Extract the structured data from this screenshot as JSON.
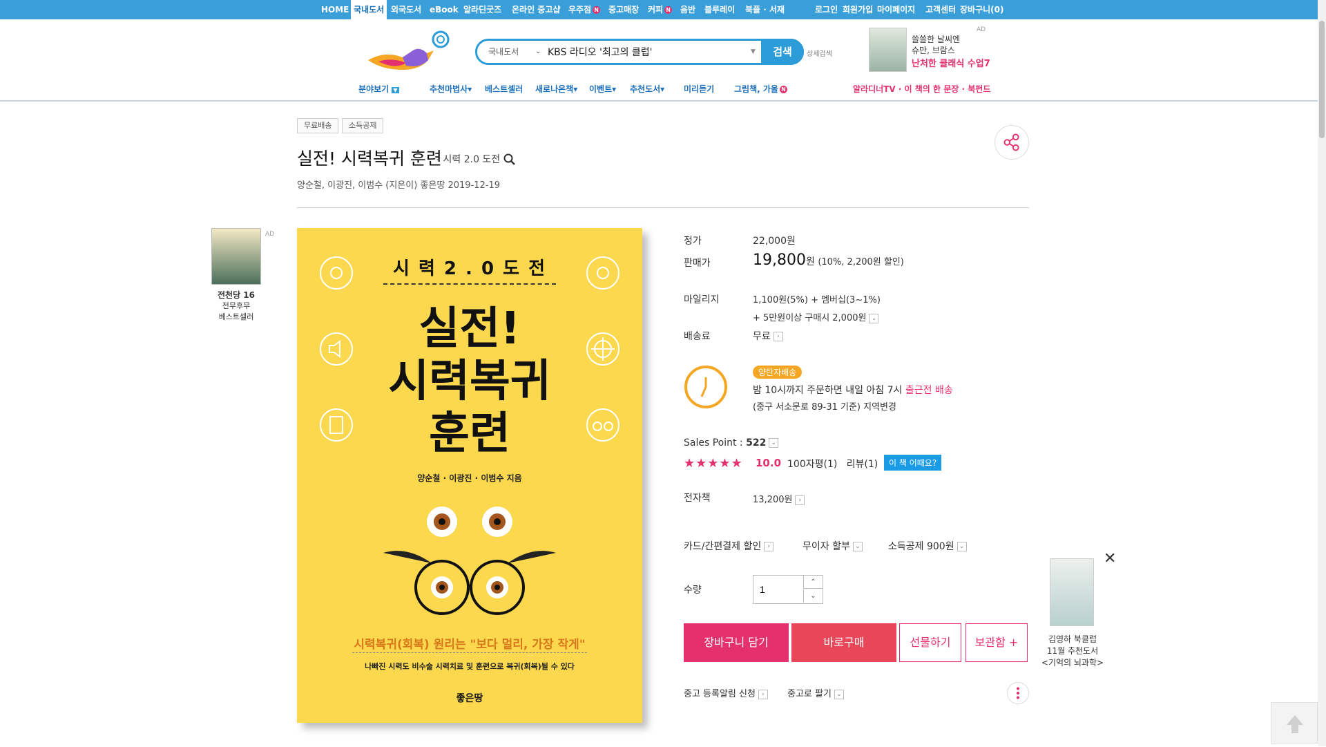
{
  "topbar": {
    "items": [
      "HOME",
      "국내도서",
      "외국도서",
      "eBook",
      "알라딘굿즈",
      "온라인 중고샵",
      "우주점",
      "중고매장",
      "커피",
      "음반",
      "블루레이",
      "북플 · 서재"
    ],
    "active": "국내도서",
    "new_badge": "N",
    "right_items": [
      "로그인",
      "회원가입",
      "마이페이지",
      "고객센터",
      "장바구니(0)"
    ]
  },
  "header": {
    "search_category": "국내도서",
    "search_value": "KBS 라디오 '최고의 클럽'",
    "search_button": "검색",
    "advanced_search": "상세검색",
    "ad_tag": "AD",
    "ad_line1": "쓸쓸한 날씨엔",
    "ad_line2": "슈만, 브람스",
    "ad_line3": "난처한 클래식 수업7"
  },
  "subnav": {
    "items": [
      "분야보기",
      "추천마법사",
      "베스트셀러",
      "새로나온책",
      "이벤트",
      "추천도서",
      "미리듣기",
      "그림책, 가을"
    ],
    "right": "알라디너TV · 이 책의 한 문장 · 북펀드"
  },
  "product": {
    "tags": [
      "무료배송",
      "소득공제"
    ],
    "title": "실전! 시력복귀 훈련",
    "subtitle": "- 시력 2.0 도전",
    "authors": "양순철,  이광진,  이범수 (지은이)  좋은땅  2019-12-19"
  },
  "side_ad": {
    "tag": "AD",
    "book_title": "전천당 16",
    "line1": "전무후무",
    "line2": "베스트셀러"
  },
  "cover": {
    "top": "시 력  2 . 0  도 전",
    "title_line1": "실전!",
    "title_line2": "시력복귀",
    "title_line3": "훈련",
    "authors": "양순철 · 이광진 · 이범수 지음",
    "slogan": "시력복귀(회복) 원리는 \"보다 멀리, 가장 작게\"",
    "desc": "나빠진 시력도 비수술 시력치료 및 훈련으로 복귀(회복)될 수 있다",
    "publisher": "좋은땅"
  },
  "pricing": {
    "list_label": "정가",
    "list_price": "22,000원",
    "sale_label": "판매가",
    "sale_price": "19,800",
    "sale_unit": "원",
    "sale_discount": "(10%, 2,200원 할인)",
    "mileage_label": "마일리지",
    "mileage_line1": "1,100원(5%) + 멤버십(3~1%)",
    "mileage_line2": "+ 5만원이상 구매시 2,000원",
    "shipping_label": "배송료",
    "shipping_value": "무료"
  },
  "delivery": {
    "badge": "양탄자배송",
    "line1_a": "밤 10시까지 주문하면 내일 아침 7시 ",
    "line1_b": "출근전 배송",
    "line2": "(중구 서소문로 89-31 기준) 지역변경"
  },
  "rating": {
    "sales_label": "Sales Point : ",
    "sales_value": "522",
    "stars": "★★★★★",
    "score": "10.0",
    "reviews": "100자평(1)   리뷰(1)",
    "how_button": "이 책 어때요?"
  },
  "ebook": {
    "label": "전자책",
    "price": "13,200원"
  },
  "benefits": [
    "카드/간편결제 할인",
    "무이자 할부",
    "소득공제 900원"
  ],
  "quantity": {
    "label": "수량",
    "value": "1"
  },
  "buttons": {
    "cart": "장바구니 담기",
    "buy": "바로구매",
    "gift": "선물하기",
    "save": "보관함 +"
  },
  "used": {
    "alert": "중고 등록알림 신청",
    "sell": "중고로 팔기"
  },
  "float_ad": {
    "line1": "김영하 북클럽",
    "line2": "11월 추천도서",
    "line3": "<기억의 뇌과학>"
  },
  "colors": {
    "topbar": "#3a9fd9",
    "accent_pink": "#e4306d",
    "buy_red": "#e8475a",
    "cover_yellow": "#fbd84e"
  }
}
